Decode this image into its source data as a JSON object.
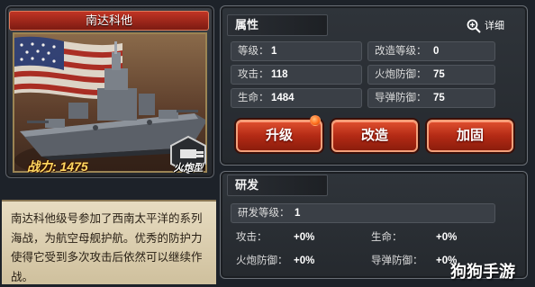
{
  "ship": {
    "name": "南达科他",
    "power_label": "战力: 1475",
    "type_label": "火炮型",
    "description": "南达科他级号参加了西南太平洋的系列海战，为航空母舰护航。优秀的防护力使得它受到多次攻击后依然可以继续作战。"
  },
  "attributes": {
    "header": "属性",
    "detail_label": "详细",
    "rows": [
      {
        "label": "等级：",
        "value": "1"
      },
      {
        "label": "攻击：",
        "value": "118"
      },
      {
        "label": "生命：",
        "value": "1484"
      },
      {
        "label": "改造等级：",
        "value": "0"
      },
      {
        "label": "火炮防御：",
        "value": "75"
      },
      {
        "label": "导弹防御：",
        "value": "75"
      }
    ]
  },
  "actions": {
    "upgrade": "升级",
    "modify": "改造",
    "reinforce": "加固"
  },
  "research": {
    "header": "研发",
    "level_label": "研发等级：",
    "level_value": "1",
    "rows": [
      {
        "label": "攻击：",
        "value": "+0%"
      },
      {
        "label": "生命：",
        "value": "+0%"
      },
      {
        "label": "火炮防御：",
        "value": "+0%"
      },
      {
        "label": "导弹防御：",
        "value": "+0%"
      }
    ]
  },
  "watermark": "狗狗手游",
  "colors": {
    "accent_red": "#b32a15",
    "gold": "#ffd860"
  }
}
